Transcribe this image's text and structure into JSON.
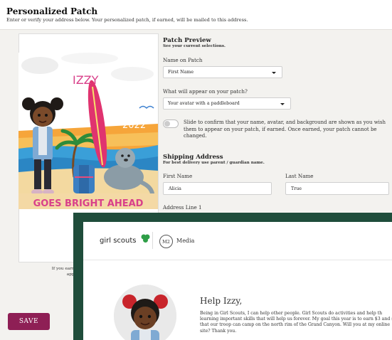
{
  "header": {
    "title": "Personalized Patch",
    "subtitle": "Enter or verify your address below. Your personalized patch, if earned, will be mailed to this address."
  },
  "patch": {
    "name": "IZZY",
    "year": "2022",
    "banner": "GOES BRIGHT AHEAD",
    "caption_line1": "If you earn it, this is",
    "caption_line2": "appear on yo"
  },
  "preview": {
    "heading": "Patch Preview",
    "subheading": "See your current selections.",
    "name_label": "Name on Patch",
    "name_value": "First Name",
    "appear_label": "What will appear on your patch?",
    "appear_value": "Your avatar with a paddleboard"
  },
  "confirm": {
    "text": "Slide to confirm that your name, avatar, and background are shown as you wish them to appear on your patch, if earned. Once earned, your patch cannot be changed."
  },
  "shipping": {
    "heading": "Shipping Address",
    "subheading": "For best delivery use parent / guardian name.",
    "first_name_label": "First Name",
    "first_name_value": "Alicia",
    "last_name_label": "Last Name",
    "last_name_value": "True",
    "address_label": "Address Line 1"
  },
  "save_label": "SAVE",
  "girlscouts": {
    "logo_text": "girl scouts",
    "m2_badge": "M2",
    "m2_label": "Media",
    "heading": "Help Izzy,",
    "body": "Being in Girl Scouts, I can help other people. Girl Scouts do activities and help th learning important skills that will help us forever. My goal this year is to earn $3 and so that our troop can camp on the north rim of the Grand Canyon. Will you at my online site? Thank you."
  },
  "colors": {
    "save_button": "#8e1f55",
    "frame_green": "#1f4d3b",
    "trefoil_green": "#2e9e47"
  },
  "icons": {
    "trefoil": "trefoil-icon",
    "dropdown": "chevron-down-icon"
  }
}
